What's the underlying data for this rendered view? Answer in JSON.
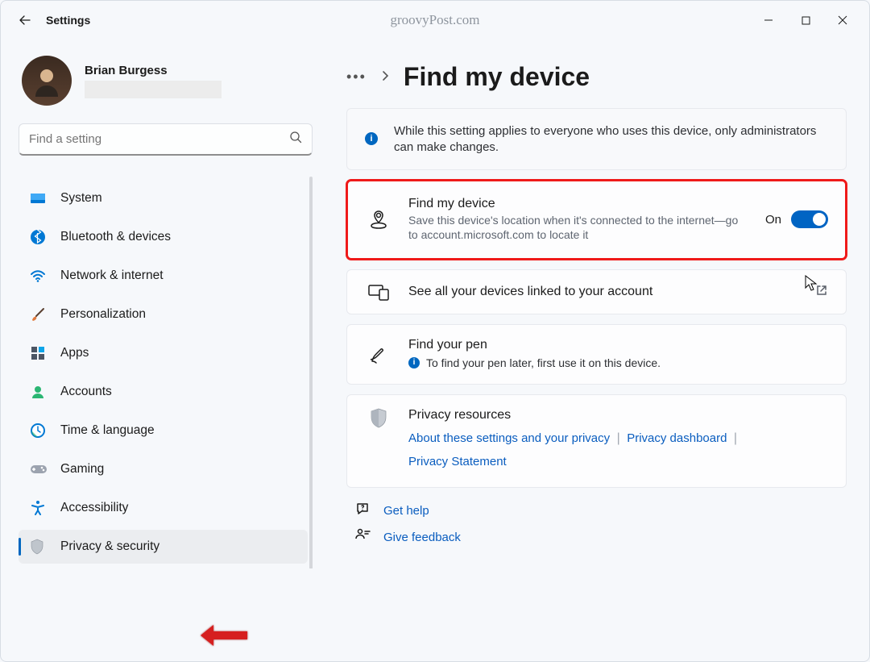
{
  "app": {
    "title": "Settings"
  },
  "watermark": "groovyPost.com",
  "user": {
    "name": "Brian Burgess"
  },
  "search": {
    "placeholder": "Find a setting"
  },
  "nav": {
    "items": [
      {
        "label": "System"
      },
      {
        "label": "Bluetooth & devices"
      },
      {
        "label": "Network & internet"
      },
      {
        "label": "Personalization"
      },
      {
        "label": "Apps"
      },
      {
        "label": "Accounts"
      },
      {
        "label": "Time & language"
      },
      {
        "label": "Gaming"
      },
      {
        "label": "Accessibility"
      },
      {
        "label": "Privacy & security"
      }
    ]
  },
  "page": {
    "title": "Find my device",
    "info_banner": "While this setting applies to everyone who uses this device, only administrators can make changes.",
    "find_device": {
      "title": "Find my device",
      "desc": "Save this device's location when it's connected to the internet—go to account.microsoft.com to locate it",
      "state_label": "On"
    },
    "linked_devices": {
      "title": "See all your devices linked to your account"
    },
    "find_pen": {
      "title": "Find your pen",
      "desc": "To find your pen later, first use it on this device."
    },
    "privacy": {
      "title": "Privacy resources",
      "link1": "About these settings and your privacy",
      "link2": "Privacy dashboard",
      "link3": "Privacy Statement"
    },
    "help": {
      "label": "Get help"
    },
    "feedback": {
      "label": "Give feedback"
    }
  }
}
